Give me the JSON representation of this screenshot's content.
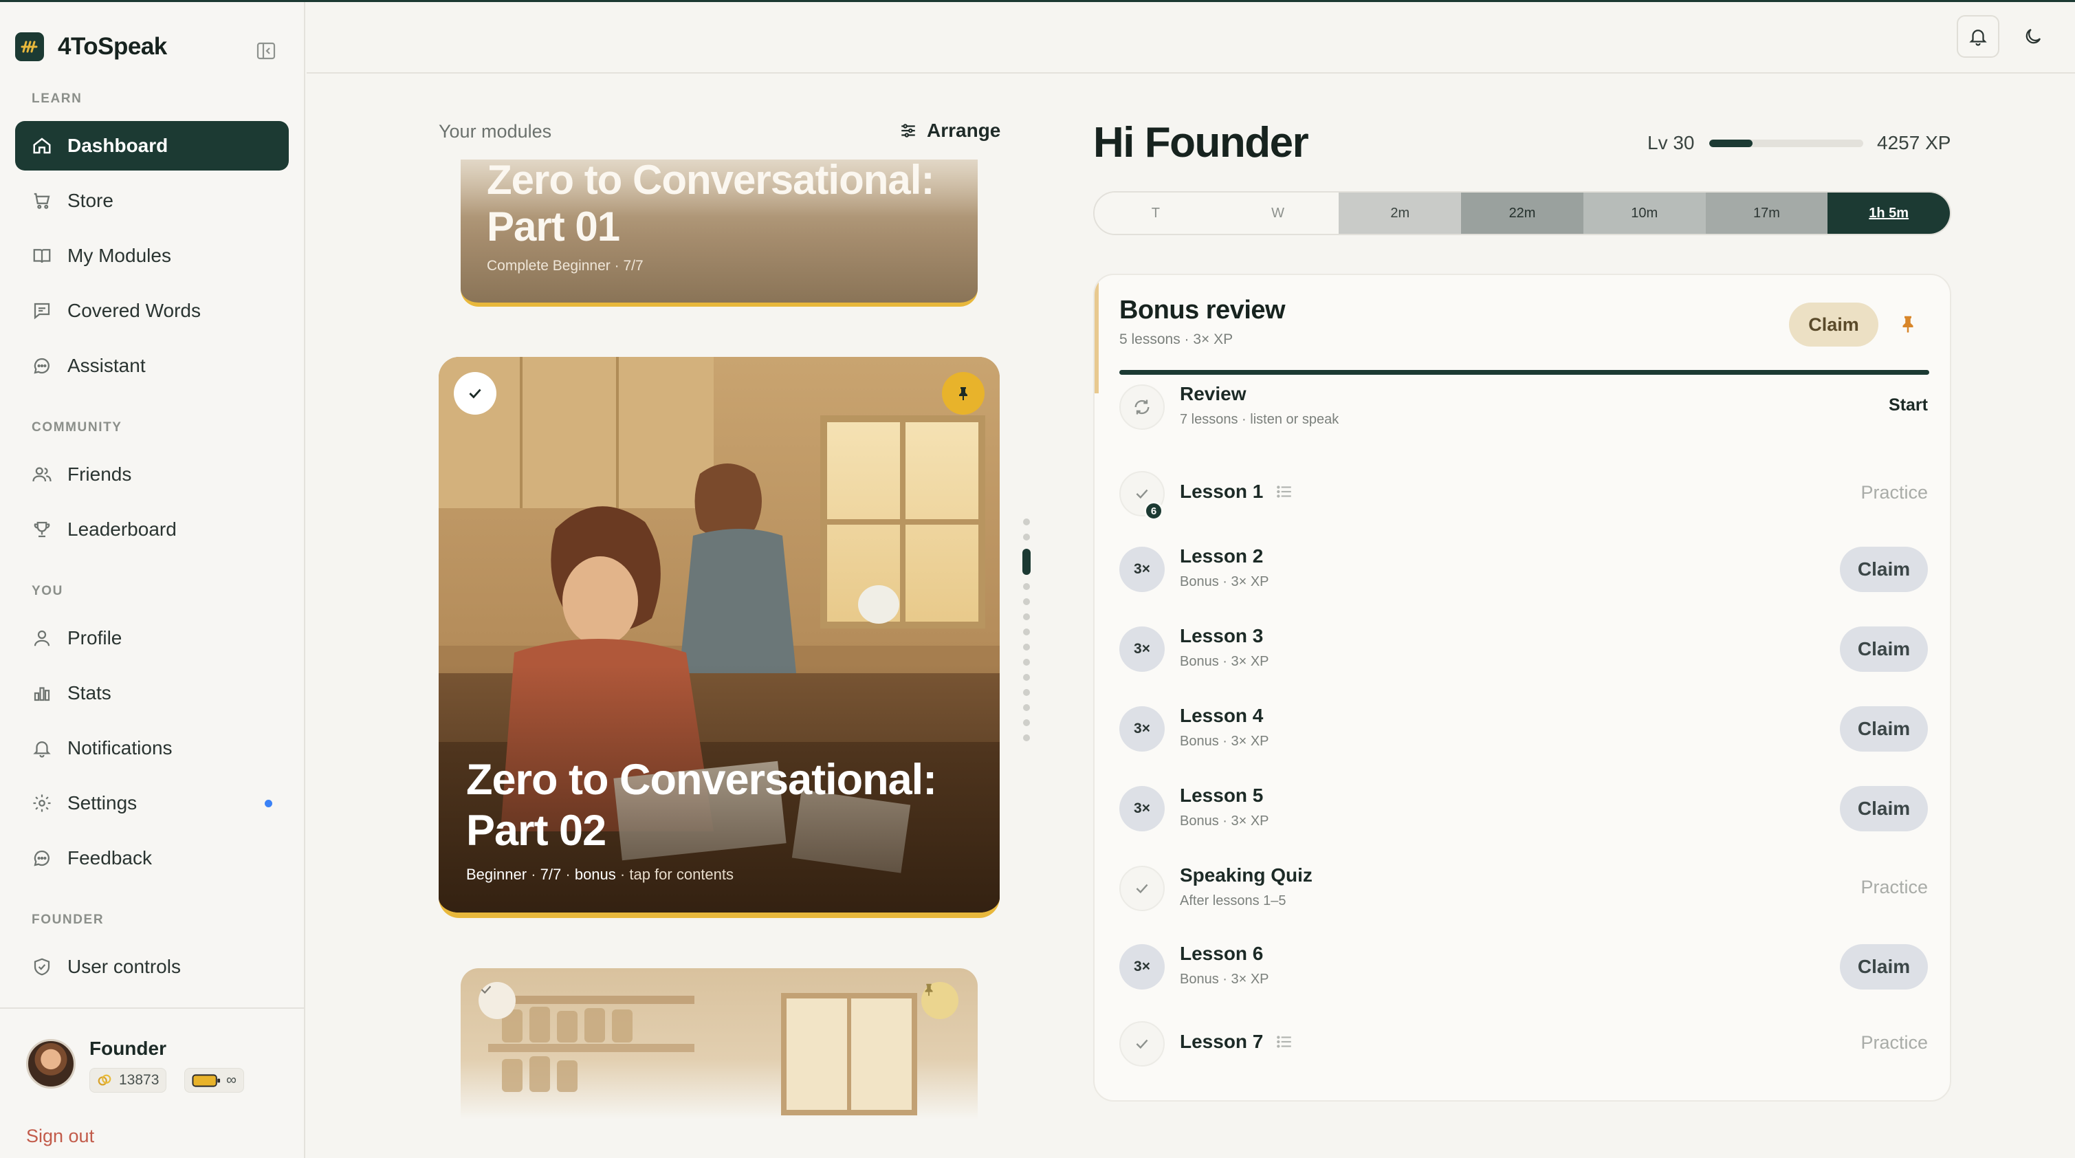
{
  "app": {
    "name": "4ToSpeak"
  },
  "sidebar": {
    "sections": {
      "learn": "LEARN",
      "community": "COMMUNITY",
      "you": "YOU",
      "founder": "FOUNDER"
    },
    "items": [
      {
        "label": "Dashboard",
        "icon": "home-icon",
        "active": true
      },
      {
        "label": "Store",
        "icon": "cart-icon"
      },
      {
        "label": "My Modules",
        "icon": "book-icon"
      },
      {
        "label": "Covered Words",
        "icon": "message-square-icon"
      },
      {
        "label": "Assistant",
        "icon": "chat-bubble-icon"
      },
      {
        "label": "Friends",
        "icon": "users-icon"
      },
      {
        "label": "Leaderboard",
        "icon": "trophy-icon"
      },
      {
        "label": "Profile",
        "icon": "user-icon"
      },
      {
        "label": "Stats",
        "icon": "bar-chart-icon"
      },
      {
        "label": "Notifications",
        "icon": "bell-icon"
      },
      {
        "label": "Settings",
        "icon": "gear-icon",
        "dot": true
      },
      {
        "label": "Feedback",
        "icon": "chat-bubble-icon"
      },
      {
        "label": "User controls",
        "icon": "shield-check-icon"
      }
    ],
    "user": {
      "name": "Founder",
      "coins": "13873",
      "energy": "∞"
    },
    "sign_out": "Sign out"
  },
  "modules": {
    "label": "Your modules",
    "arrange_label": "Arrange",
    "cards": [
      {
        "title_line1": "Zero to Conversational:",
        "title_line2": "Part 01",
        "level": "Complete Beginner",
        "progress": "7/7"
      },
      {
        "title_line1": "Zero to Conversational:",
        "title_line2": "Part 02",
        "level": "Beginner",
        "progress": "7/7",
        "bonus": "bonus",
        "hint": "tap for contents"
      }
    ],
    "pager": {
      "count": 14,
      "active_index": 2
    }
  },
  "header": {
    "greeting": "Hi Founder",
    "level": "Lv 30",
    "xp": "4257 XP",
    "level_progress": 0.28
  },
  "timeline": [
    {
      "label": "T",
      "bg": "#f7f6f2",
      "fg": "#8d918d"
    },
    {
      "label": "W",
      "bg": "#f7f6f2",
      "fg": "#8d918d"
    },
    {
      "label": "2m",
      "bg": "#c9cbc8",
      "fg": "#3a4440"
    },
    {
      "label": "22m",
      "bg": "#9aa19e",
      "fg": "#24302c"
    },
    {
      "label": "10m",
      "bg": "#b7bcb9",
      "fg": "#2c3633"
    },
    {
      "label": "17m",
      "bg": "#a4aaa7",
      "fg": "#2c3633"
    },
    {
      "label": "1h 5m",
      "bg": "#1c3a33",
      "fg": "#ffffff"
    }
  ],
  "bonus": {
    "title": "Bonus review",
    "subtitle": "5 lessons · 3× XP",
    "claim_label": "Claim"
  },
  "lessons": [
    {
      "title": "Review",
      "sub": "7 lessons · listen or speak",
      "icon": "refresh-icon",
      "action": "Start",
      "kind": "start"
    },
    {
      "title": "Lesson 1",
      "sub": "",
      "icon": "check-icon",
      "badge": "6",
      "action": "Practice",
      "kind": "practice",
      "list": true
    },
    {
      "title": "Lesson 2",
      "sub": "Bonus · 3× XP",
      "icon": "3×",
      "action": "Claim",
      "kind": "claim"
    },
    {
      "title": "Lesson 3",
      "sub": "Bonus · 3× XP",
      "icon": "3×",
      "action": "Claim",
      "kind": "claim"
    },
    {
      "title": "Lesson 4",
      "sub": "Bonus · 3× XP",
      "icon": "3×",
      "action": "Claim",
      "kind": "claim"
    },
    {
      "title": "Lesson 5",
      "sub": "Bonus · 3× XP",
      "icon": "3×",
      "action": "Claim",
      "kind": "claim"
    },
    {
      "title": "Speaking Quiz",
      "sub": "After lessons 1–5",
      "icon": "check-icon",
      "action": "Practice",
      "kind": "practice"
    },
    {
      "title": "Lesson 6",
      "sub": "Bonus · 3× XP",
      "icon": "3×",
      "action": "Claim",
      "kind": "claim"
    },
    {
      "title": "Lesson 7",
      "sub": "",
      "icon": "check-icon",
      "action": "Practice",
      "kind": "practice",
      "list": true
    }
  ]
}
